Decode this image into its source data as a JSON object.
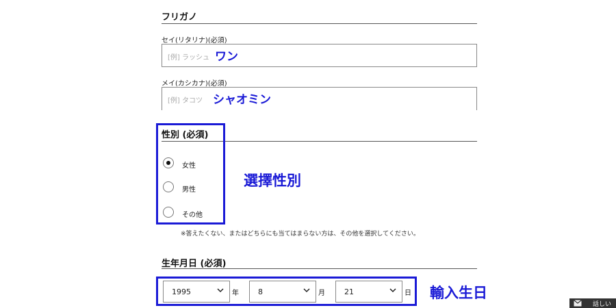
{
  "furigana": {
    "title": "フリガノ",
    "sei": {
      "label": "セイ(リタリナ)(必須)",
      "placeholder": "[例] ラッシュ",
      "annotation": "ワン"
    },
    "mei": {
      "label": "メイ(カシカナ)(必須)",
      "placeholder": "[例] タコツ",
      "annotation": "シャオミン"
    }
  },
  "gender": {
    "title": "性別 (必須)",
    "annotation": "選擇性別",
    "options": [
      {
        "label": "女性",
        "checked": true
      },
      {
        "label": "男性",
        "checked": false
      },
      {
        "label": "その他",
        "checked": false
      }
    ],
    "note": "※答えたくない、またはどちらにも当てはまらない方は、その他を選択してください。"
  },
  "birthday": {
    "title": "生年月日 (必須)",
    "annotation": "輸入生日",
    "year": {
      "value": "1995",
      "unit": "年"
    },
    "month": {
      "value": "8",
      "unit": "月"
    },
    "day": {
      "value": "21",
      "unit": "日"
    }
  },
  "chat": {
    "label": "話しい"
  },
  "colors": {
    "annotation_blue": "#1a1ad6"
  }
}
